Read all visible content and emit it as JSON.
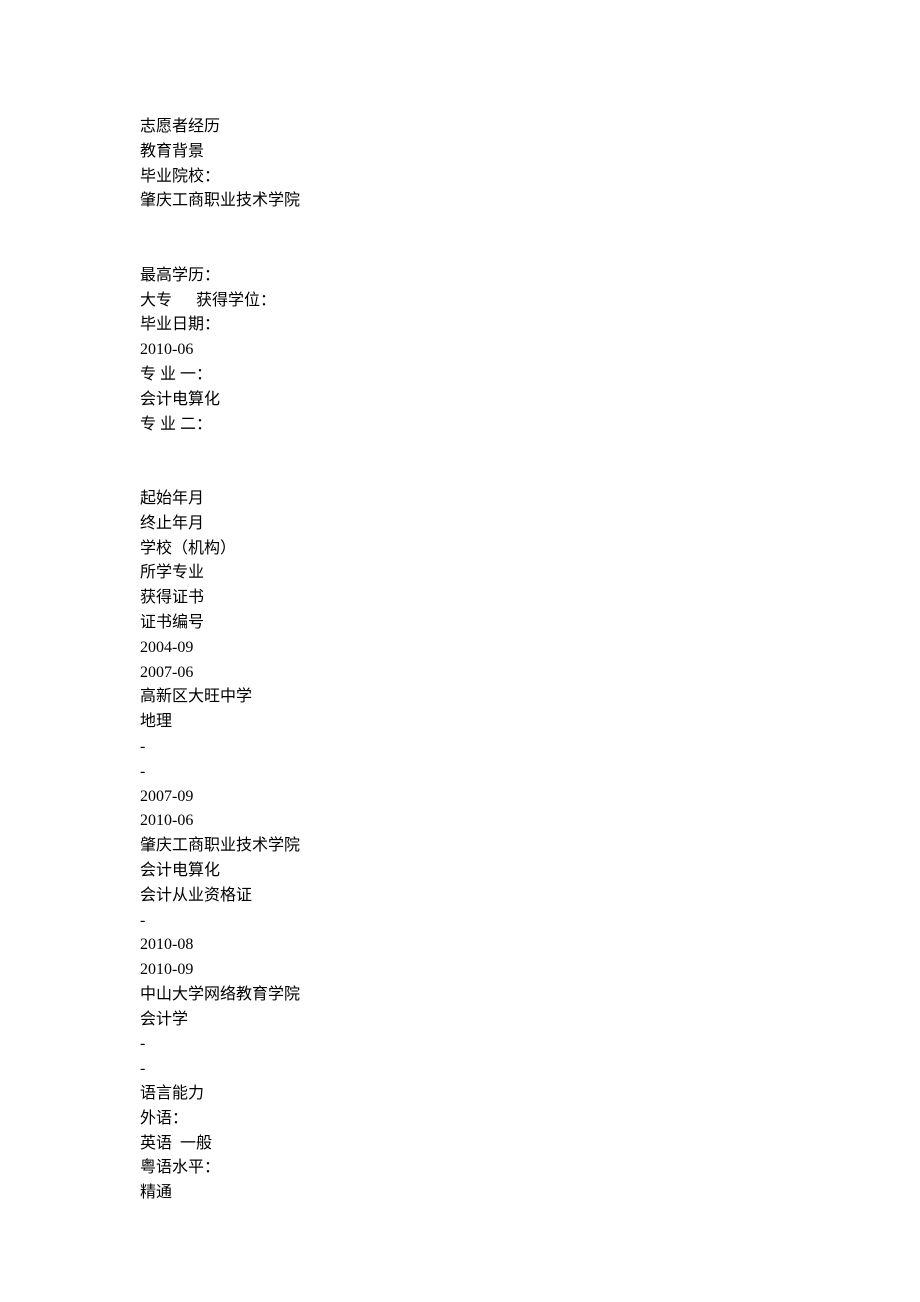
{
  "l1": "志愿者经历",
  "l2": "教育背景",
  "l3": "毕业院校：",
  "l4": "肇庆工商职业技术学院",
  "l5": "最高学历：",
  "l6": "大专      获得学位：",
  "l7": "毕业日期：",
  "l8": "2010-06",
  "l9": "专 业 一：",
  "l10": "会计电算化",
  "l11": "专 业 二：",
  "l12": "起始年月",
  "l13": "终止年月",
  "l14": "学校（机构）",
  "l15": "所学专业",
  "l16": "获得证书",
  "l17": "证书编号",
  "l18": "2004-09",
  "l19": "2007-06",
  "l20": "高新区大旺中学",
  "l21": "地理",
  "l22": "-",
  "l23": "-",
  "l24": "2007-09",
  "l25": "2010-06",
  "l26": "肇庆工商职业技术学院",
  "l27": "会计电算化",
  "l28": "会计从业资格证",
  "l29": "-",
  "l30": "2010-08",
  "l31": "2010-09",
  "l32": "中山大学网络教育学院",
  "l33": "会计学",
  "l34": "-",
  "l35": "-",
  "l36": "语言能力",
  "l37": "外语：",
  "l38": "英语  一般",
  "l39": "粤语水平：",
  "l40": "精通"
}
